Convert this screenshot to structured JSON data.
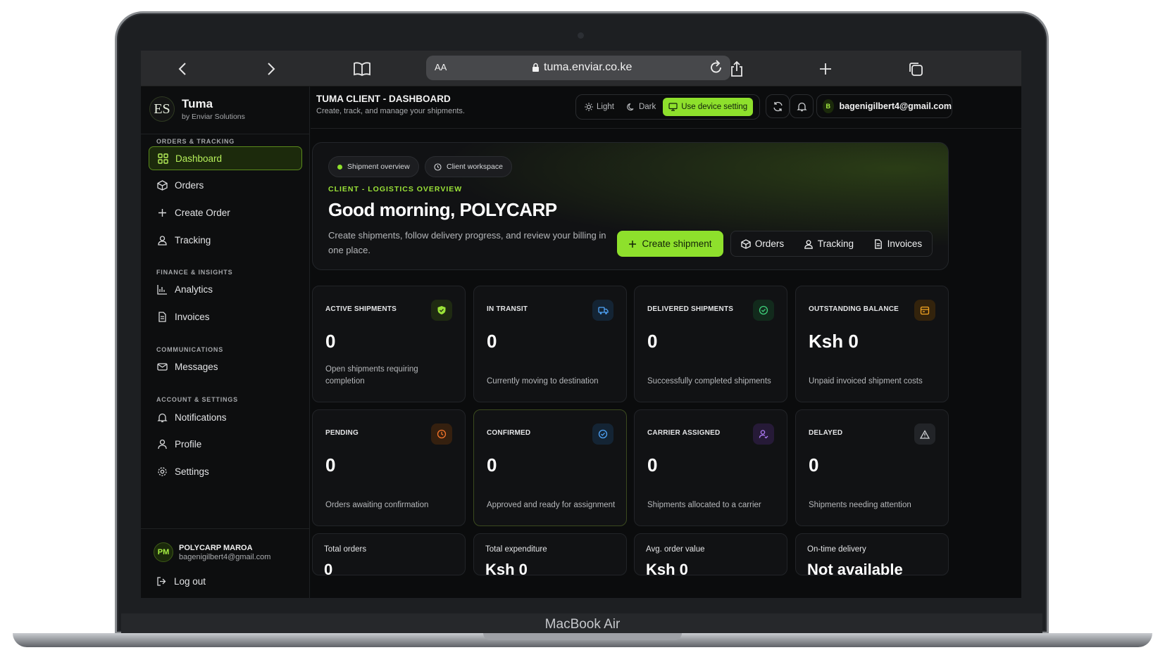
{
  "device": {
    "brand": "MacBook Air"
  },
  "browser": {
    "aa_label": "AA",
    "url": "tuma.enviar.co.ke"
  },
  "sidebar": {
    "logo_mark": "ES",
    "app_name": "Tuma",
    "app_sub": "by Enviar Solutions",
    "sections": [
      {
        "title": "ORDERS & TRACKING",
        "items": [
          {
            "label": "Dashboard",
            "icon": "grid-icon",
            "active": true
          },
          {
            "label": "Orders",
            "icon": "box-icon"
          },
          {
            "label": "Create Order",
            "icon": "plus-icon"
          },
          {
            "label": "Tracking",
            "icon": "person-pin-icon"
          }
        ]
      },
      {
        "title": "FINANCE & INSIGHTS",
        "items": [
          {
            "label": "Analytics",
            "icon": "bar-chart-icon"
          },
          {
            "label": "Invoices",
            "icon": "document-icon"
          }
        ]
      },
      {
        "title": "COMMUNICATIONS",
        "items": [
          {
            "label": "Messages",
            "icon": "mail-icon"
          }
        ]
      },
      {
        "title": "ACCOUNT & SETTINGS",
        "items": [
          {
            "label": "Notifications",
            "icon": "bell-icon"
          },
          {
            "label": "Profile",
            "icon": "user-icon"
          },
          {
            "label": "Settings",
            "icon": "gear-icon"
          }
        ]
      }
    ],
    "user": {
      "initials": "PM",
      "name": "POLYCARP MAROA",
      "email": "bagenigilbert4@gmail.com"
    },
    "logout_label": "Log out"
  },
  "header": {
    "title": "TUMA CLIENT - DASHBOARD",
    "subtitle": "Create, track, and manage your shipments.",
    "theme": {
      "light": "Light",
      "dark": "Dark",
      "device": "Use device setting",
      "selected": "device"
    },
    "account": {
      "initial": "B",
      "email": "bagenigilbert4@gmail.com"
    }
  },
  "hero": {
    "pill_overview": "Shipment overview",
    "pill_workspace": "Client workspace",
    "eyebrow": "CLIENT - LOGISTICS OVERVIEW",
    "greeting": "Good morning, POLYCARP",
    "description": "Create shipments, follow delivery progress, and review your billing in one place.",
    "create_label": "Create shipment",
    "quick": {
      "orders": "Orders",
      "tracking": "Tracking",
      "invoices": "Invoices"
    }
  },
  "stats": [
    {
      "label": "ACTIVE SHIPMENTS",
      "value": "0",
      "desc": "Open shipments requiring completion",
      "icon": "shield-icon",
      "color": "#9be338"
    },
    {
      "label": "IN TRANSIT",
      "value": "0",
      "desc": "Currently moving to destination",
      "icon": "truck-icon",
      "color": "#4fa3f7"
    },
    {
      "label": "DELIVERED SHIPMENTS",
      "value": "0",
      "desc": "Successfully completed shipments",
      "icon": "check-circle-icon",
      "color": "#3ecf7a"
    },
    {
      "label": "OUTSTANDING BALANCE",
      "value": "Ksh 0",
      "desc": "Unpaid invoiced shipment costs",
      "icon": "wallet-icon",
      "color": "#f5a623"
    },
    {
      "label": "PENDING",
      "value": "0",
      "desc": "Orders awaiting confirmation",
      "icon": "clock-icon",
      "color": "#f5742a"
    },
    {
      "label": "CONFIRMED",
      "value": "0",
      "desc": "Approved and ready for assignment",
      "icon": "check-badge-icon",
      "color": "#4fa3f7"
    },
    {
      "label": "CARRIER ASSIGNED",
      "value": "0",
      "desc": "Shipments allocated to a carrier",
      "icon": "user-check-icon",
      "color": "#b07cf7"
    },
    {
      "label": "DELAYED",
      "value": "0",
      "desc": "Shipments needing attention",
      "icon": "warning-icon",
      "color": "#d0d2d5"
    }
  ],
  "summary": [
    {
      "label": "Total orders",
      "value": "0"
    },
    {
      "label": "Total expenditure",
      "value": "Ksh 0"
    },
    {
      "label": "Avg. order value",
      "value": "Ksh 0"
    },
    {
      "label": "On-time delivery",
      "value": "Not available"
    }
  ]
}
